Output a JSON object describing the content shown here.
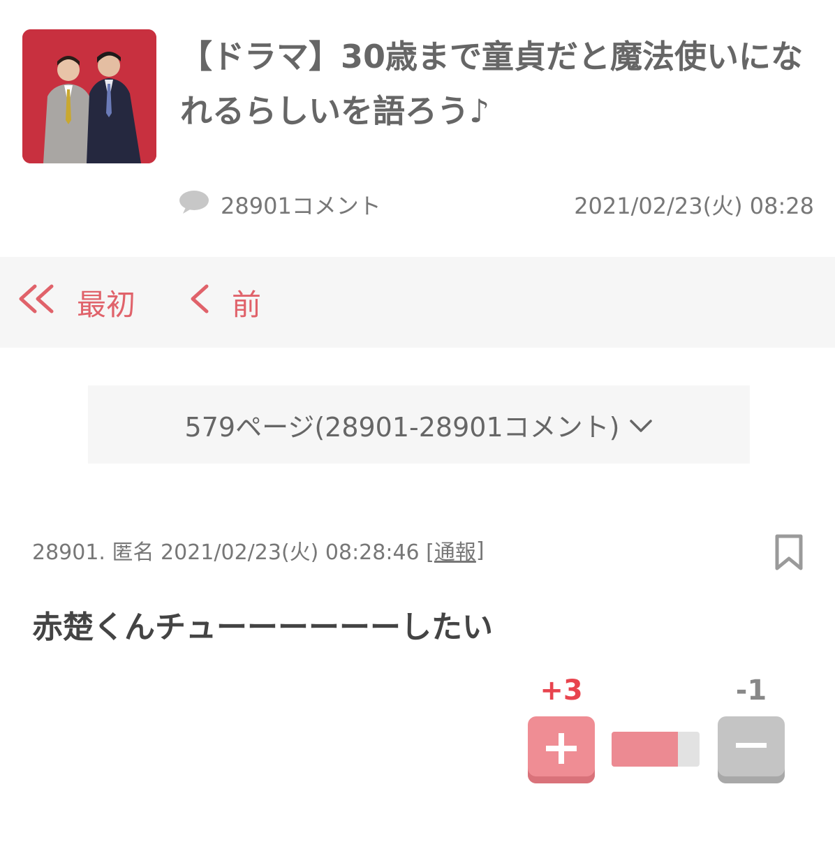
{
  "article": {
    "title": "【ドラマ】30歳まで童貞だと魔法使いになれるらしいを語ろう♪",
    "comment_count_label": "28901コメント",
    "date": "2021/02/23(火) 08:28"
  },
  "nav": {
    "first_label": "最初",
    "prev_label": "前"
  },
  "page_select": {
    "label": "579ページ(28901-28901コメント)"
  },
  "comment": {
    "meta_prefix": "28901. 匿名 2021/02/23(火) 08:28:46 [",
    "report_label": "通報",
    "meta_suffix": "]",
    "body": "赤楚くんチューーーーーーしたい",
    "plus_count": "+3",
    "minus_count": "-1",
    "plus_ratio": 0.75
  },
  "icons": {
    "comment": "speech-bubble-icon",
    "first": "double-chevron-left-icon",
    "prev": "chevron-left-icon",
    "dropdown": "chevron-down-icon",
    "bookmark": "bookmark-icon",
    "plus": "plus-icon",
    "minus": "minus-icon"
  },
  "colors": {
    "accent": "#e0626a",
    "plus": "#ef8d94",
    "minus": "#c4c4c4",
    "thumb_bg": "#c8303f"
  }
}
